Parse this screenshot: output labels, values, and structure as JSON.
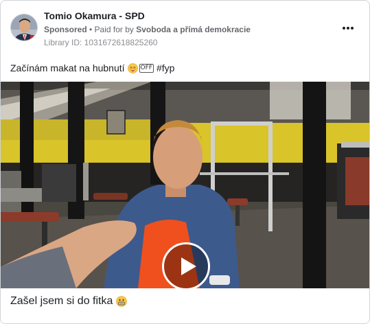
{
  "ad": {
    "page_name": "Tomio Okamura - SPD",
    "sponsored_label": "Sponsored",
    "separator": " • ",
    "paid_for_prefix": "Paid for by ",
    "payer": "Svoboda a přímá demokracie",
    "library_id": "Library ID: 1031672618825260",
    "caption_text": "Začínám makat na hubnutí",
    "caption_emoji_tag": "OFF",
    "caption_hashtag": "#fyp",
    "video_footer_text": "Zašel jsem si do fitka"
  },
  "icons": {
    "more": "more-options-icon",
    "play": "play-icon",
    "face": "grinning-face-emoji",
    "tag": "off-tag-emoji",
    "grin": "grimacing-face-emoji"
  },
  "colors": {
    "text_primary": "#1c1e21",
    "text_secondary": "#65676b",
    "gym_wall_yellow": "#d9c42a",
    "shirt_orange": "#f0501e",
    "towel_blue": "#3d5a8c"
  }
}
